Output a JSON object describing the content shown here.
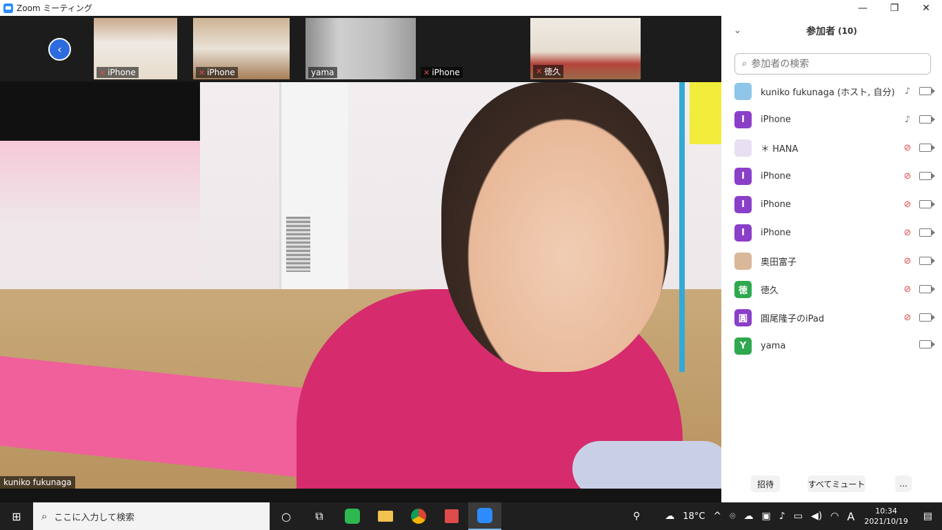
{
  "window": {
    "title": "Zoom ミーティング",
    "minimize": "—",
    "maximize": "❐",
    "close": "✕"
  },
  "thumbnails": [
    {
      "name": "iPhone",
      "muted": true
    },
    {
      "name": "iPhone",
      "muted": true
    },
    {
      "name": "yama",
      "muted": false
    },
    {
      "name": "iPhone",
      "muted": true
    },
    {
      "name": "徳久",
      "muted": true
    }
  ],
  "main_video": {
    "name": "kuniko fukunaga"
  },
  "participants_panel": {
    "title": "参加者",
    "count": "(10)",
    "search_placeholder": "参加者の検索",
    "participants": [
      {
        "name": "kuniko fukunaga (ホスト, 自分)",
        "avatar_text": "",
        "avatar_color": "#8ec5e8",
        "mic": "on",
        "video": true
      },
      {
        "name": "iPhone",
        "avatar_text": "I",
        "avatar_color": "#8a3fc9",
        "mic": "on",
        "video": true
      },
      {
        "name": "＊ HANA",
        "avatar_text": "",
        "avatar_color": "#e9dff2",
        "mic": "off",
        "video": true
      },
      {
        "name": "iPhone",
        "avatar_text": "I",
        "avatar_color": "#8a3fc9",
        "mic": "off",
        "video": true
      },
      {
        "name": "iPhone",
        "avatar_text": "I",
        "avatar_color": "#8a3fc9",
        "mic": "off",
        "video": true
      },
      {
        "name": "iPhone",
        "avatar_text": "I",
        "avatar_color": "#8a3fc9",
        "mic": "off",
        "video": true
      },
      {
        "name": "奥田富子",
        "avatar_text": "",
        "avatar_color": "#d9b89a",
        "mic": "off",
        "video": true
      },
      {
        "name": "徳久",
        "avatar_text": "徳",
        "avatar_color": "#2fa84f",
        "mic": "off",
        "video": true
      },
      {
        "name": "圓尾隆子のiPad",
        "avatar_text": "圓",
        "avatar_color": "#8a3fc9",
        "mic": "off",
        "video": true
      },
      {
        "name": "yama",
        "avatar_text": "Y",
        "avatar_color": "#2fa84f",
        "mic": "none",
        "video": true
      }
    ],
    "footer": {
      "invite": "招待",
      "mute_all": "すべてミュート",
      "more": "..."
    }
  },
  "taskbar": {
    "search_placeholder": "ここに入力して検索",
    "weather": "18°C",
    "ime": "A",
    "time": "10:34",
    "date": "2021/10/19"
  },
  "colors": {
    "accent": "#2d8cff",
    "muted_red": "#e04b4b",
    "avatar_purple": "#8a3fc9",
    "avatar_green": "#2fa84f"
  }
}
